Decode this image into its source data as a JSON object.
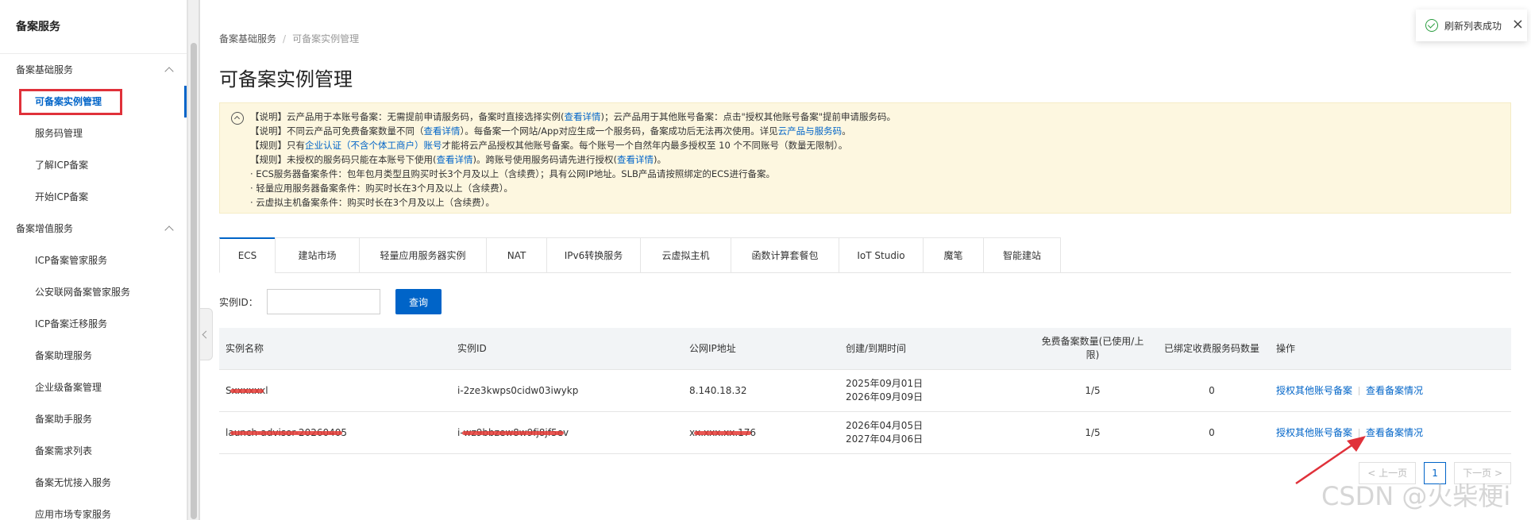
{
  "sidebar": {
    "title": "备案服务",
    "groups": [
      {
        "label": "备案基础服务",
        "items": [
          "可备案实例管理",
          "服务码管理",
          "了解ICP备案",
          "开始ICP备案"
        ]
      },
      {
        "label": "备案增值服务",
        "items": [
          "ICP备案管家服务",
          "公安联网备案管家服务",
          "ICP备案迁移服务",
          "备案助理服务",
          "企业级备案管理",
          "备案助手服务",
          "备案需求列表",
          "备案无忧接入服务",
          "应用市场专家服务"
        ]
      }
    ]
  },
  "breadcrumb": {
    "parent": "备案基础服务",
    "separator": "/",
    "current": "可备案实例管理"
  },
  "page_title": "可备案实例管理",
  "notice": {
    "l1_a": "【说明】云产品用于本账号备案：无需提前申请服务码，备案时直接选择实例(",
    "l1_link": "查看详情",
    "l1_b": ")；云产品用于其他账号备案：点击\"授权其他账号备案\"提前申请服务码。",
    "l2_a": "【说明】不同云产品可免费备案数量不同（",
    "l2_link": "查看详情",
    "l2_b": "）。每备案一个网站/App对应生成一个服务码，备案成功后无法再次使用。详见",
    "l2_link2": "云产品与服务码",
    "l2_c": "。",
    "l3_a": "【规则】只有",
    "l3_link": "企业认证（不含个体工商户）账号",
    "l3_b": "才能将云产品授权其他账号备案。每个账号一个自然年内最多授权至 10 个不同账号（数量无限制）。",
    "l4_a": "【规则】未授权的服务码只能在本账号下使用(",
    "l4_link": "查看详情",
    "l4_b": ")。跨账号使用服务码请先进行授权(",
    "l4_link2": "查看详情",
    "l4_c": ")。",
    "l5": "· ECS服务器备案条件：包年包月类型且购买时长3个月及以上（含续费）；具有公网IP地址。SLB产品请按照绑定的ECS进行备案。",
    "l6": "· 轻量应用服务器备案条件：购买时长在3个月及以上（含续费）。",
    "l7": "· 云虚拟主机备案条件：购买时长在3个月及以上（含续费）。"
  },
  "tabs": [
    "ECS",
    "建站市场",
    "轻量应用服务器实例",
    "NAT",
    "IPv6转换服务",
    "云虚拟主机",
    "函数计算套餐包",
    "IoT Studio",
    "魔笔",
    "智能建站"
  ],
  "filter": {
    "label": "实例ID：",
    "input_value": "",
    "query_label": "查询"
  },
  "table": {
    "headers": [
      "实例名称",
      "实例ID",
      "公网IP地址",
      "创建/到期时间",
      "免费备案数量(已使用/上限)",
      "已绑定收费服务码数量",
      "操作"
    ],
    "rows": [
      {
        "name": "Sxxxxxxl",
        "id": "i-2ze3kwps0cidw03iwykp",
        "ip": "8.140.18.32",
        "created": "2025年09月01日",
        "expires": "2026年09月09日",
        "free_quota": "1/5",
        "bound": "0",
        "action1": "授权其他账号备案",
        "action2": "查看备案情况"
      },
      {
        "name": "launch-advisor-20260405",
        "id": "i-wz9bbzew8w9fj8jf5ev",
        "ip": "xx.xxx.xx.176",
        "created": "2026年04月05日",
        "expires": "2027年04月06日",
        "free_quota": "1/5",
        "bound": "0",
        "action1": "授权其他账号备案",
        "action2": "查看备案情况"
      }
    ]
  },
  "pager": {
    "prev": "< 上一页",
    "page": "1",
    "next": "下一页 >"
  },
  "toast": {
    "text": "刷新列表成功",
    "close": "×"
  },
  "watermark": "CSDN @火柴梗i",
  "colors": {
    "accent": "#0064c8",
    "highlight": "#e0313a",
    "notice_bg": "#fdf7e0"
  }
}
